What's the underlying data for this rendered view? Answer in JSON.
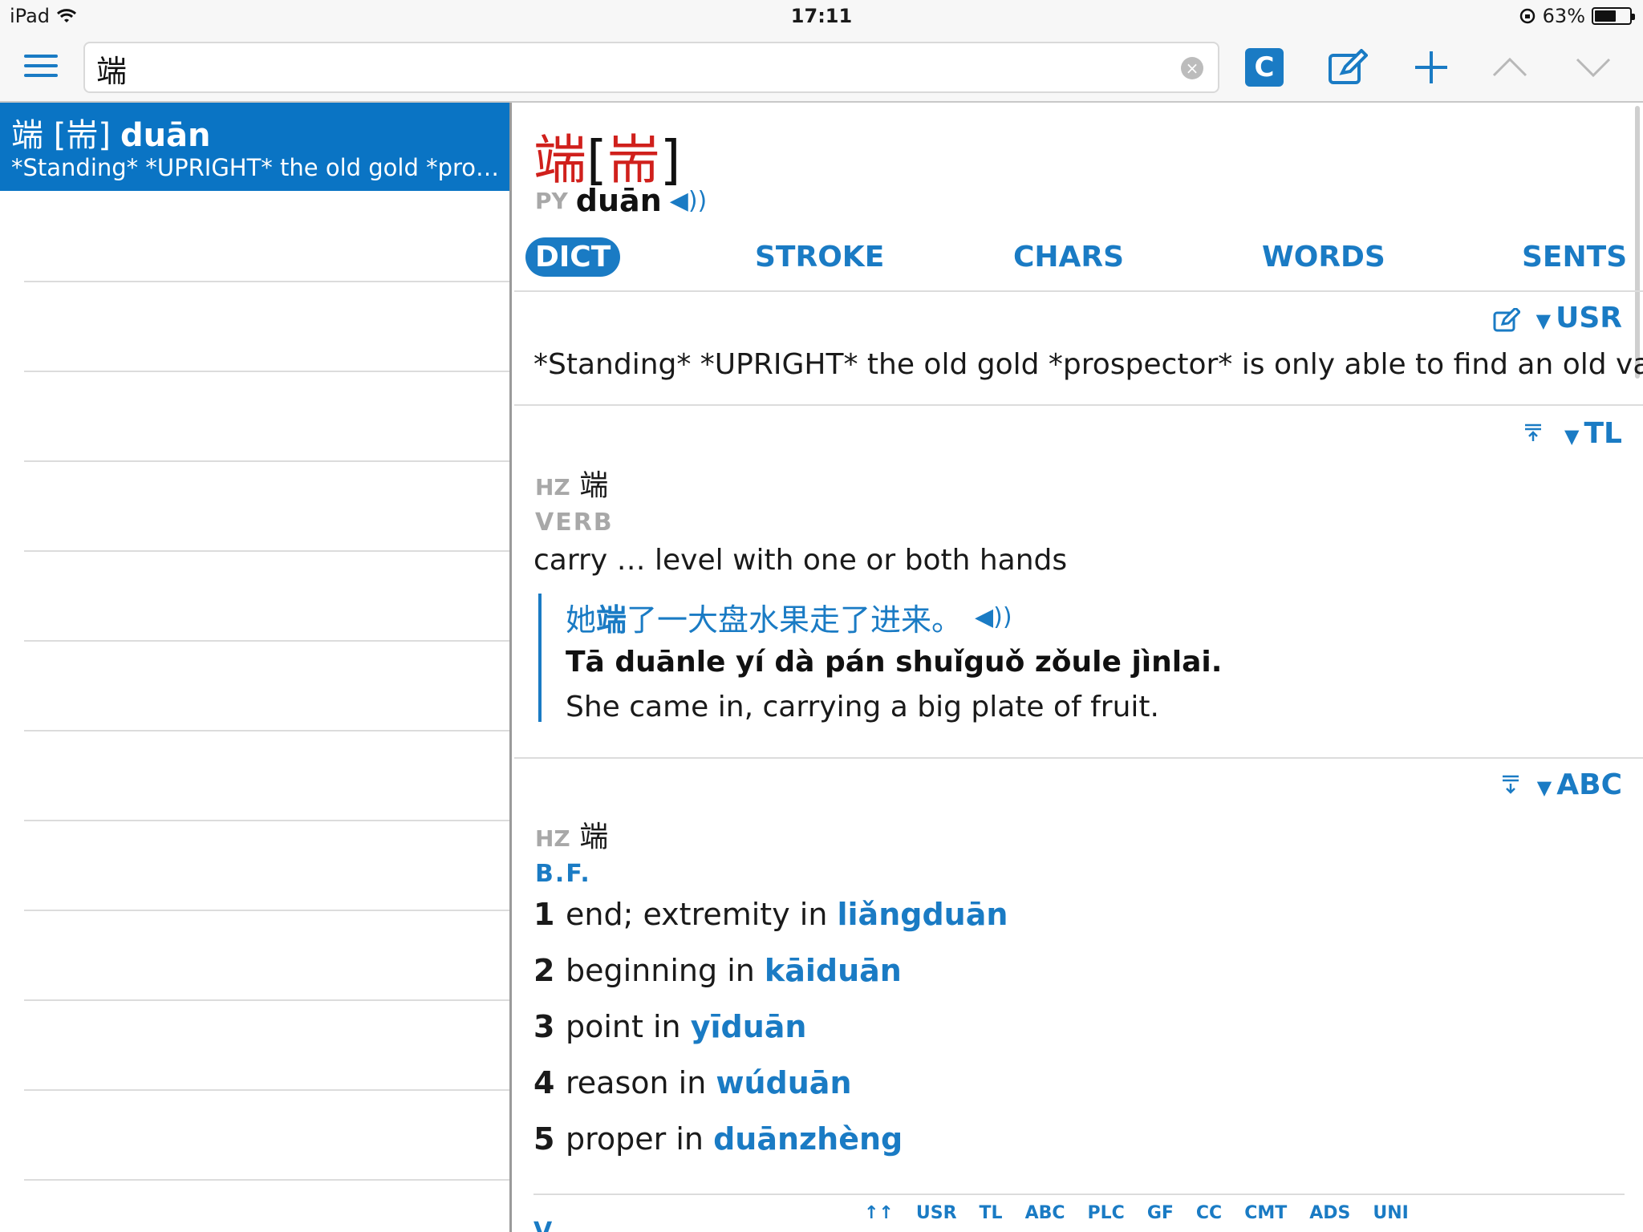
{
  "status_bar": {
    "device": "iPad",
    "time": "17:11",
    "battery": "63%",
    "battery_level": 0.63
  },
  "toolbar": {
    "menu_icon": "hamburger-menu-icon",
    "search_value": "端",
    "clear_icon": "clear-circle-icon",
    "c_button_label": "C",
    "icons": [
      "compose-icon",
      "plus-icon",
      "chevron-up-icon",
      "chevron-down-icon"
    ]
  },
  "results": [
    {
      "hanzi": "端 [耑]",
      "pinyin": "duān",
      "snippet": "*Standing* *UPRIGHT* the old gold *prosp…"
    }
  ],
  "entry": {
    "headword_char": "端",
    "headword_variant": "耑",
    "py_tag": "PY",
    "pinyin": "duān",
    "tabs": [
      "DICT",
      "STROKE",
      "CHARS",
      "WORDS",
      "SENTS"
    ],
    "active_tab": "DICT",
    "usr_section": {
      "label": "USR",
      "text": "*Standing* *UPRIGHT* the old gold *prospector* is only able to find an old vase."
    },
    "tl_section": {
      "label": "TL",
      "hz_tag": "HZ",
      "hz": "端",
      "pos": "VERB",
      "definition": "carry … level with one or both hands",
      "example_zh_pre": "她",
      "example_zh_bold": "端",
      "example_zh_post": "了一大盘水果走了进来。",
      "example_py_pre": "Tā ",
      "example_py_bold": "duān",
      "example_py_post": "le yí dà pán shuǐguǒ zǒule jìnlai.",
      "example_en": "She came in, carrying a big plate of fruit."
    },
    "abc_section": {
      "label": "ABC",
      "hz_tag": "HZ",
      "hz": "端",
      "pos": "B.F.",
      "senses": [
        {
          "num": "1",
          "text": "end; extremity in ",
          "link": "liǎngduān"
        },
        {
          "num": "2",
          "text": "beginning in ",
          "link": "kāiduān"
        },
        {
          "num": "3",
          "text": "point in ",
          "link": "yīduān"
        },
        {
          "num": "4",
          "text": "reason in ",
          "link": "wúduān"
        },
        {
          "num": "5",
          "text": "proper in ",
          "link": "duānzhèng"
        }
      ]
    },
    "footer_links": [
      "↑↑",
      "USR",
      "TL",
      "ABC",
      "PLC",
      "GF",
      "CC",
      "CMT",
      "ADS",
      "UNI"
    ],
    "footer_partial": "V"
  }
}
